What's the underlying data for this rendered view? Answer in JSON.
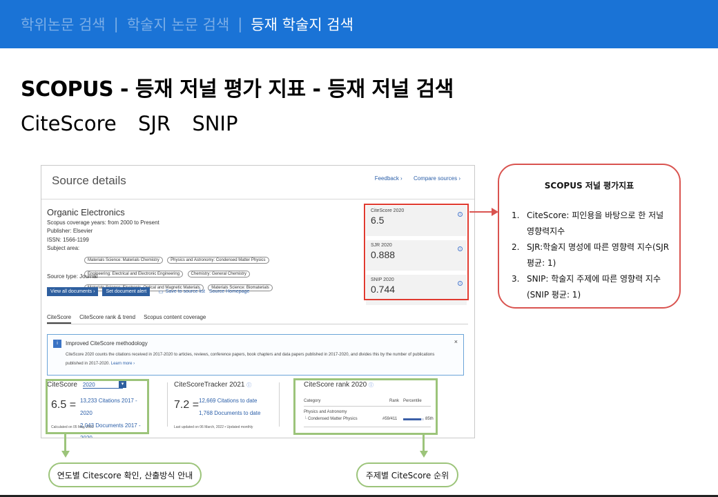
{
  "topbar": {
    "tabs": [
      {
        "label": "학위논문 검색"
      },
      {
        "label": "학술지 논문 검색"
      },
      {
        "label": "등재 학술지 검색"
      }
    ],
    "separator": "|",
    "colors": {
      "bar": "#1a73d6"
    }
  },
  "slide": {
    "title": "SCOPUS  -  등재 저널 평가 지표  -  등재 저널 검색",
    "subtitle": [
      "CiteScore",
      "SJR",
      "SNIP"
    ]
  },
  "source": {
    "header": "Source details",
    "feedback": "Feedback ›",
    "compare": "Compare sources ›",
    "journal_name": "Organic Electronics",
    "coverage_label": "Scopus coverage years:",
    "coverage_value": "from 2000 to Present",
    "publisher_label": "Publisher:",
    "publisher_value": "Elsevier",
    "issn_label": "ISSN:",
    "issn_value": "1566-1199",
    "subject_label": "Subject area:",
    "subjects": [
      "Materials Science: Materials Chemistry",
      "Physics and Astronomy: Condensed Matter Physics",
      "Engineering: Electrical and Electronic Engineering",
      "Chemistry: General Chemistry",
      "Materials Science: Electronic, Optical and Magnetic Materials",
      "Materials Science: Biomaterials"
    ],
    "source_type_label": "Source type:",
    "source_type_value": "Journal",
    "btn_view_all": "View all documents ›",
    "btn_alert": "Set document alert",
    "save_link": "Save to source list",
    "homepage_link": "Source Homepage",
    "metrics": [
      {
        "label": "CiteScore 2020",
        "value": "6.5"
      },
      {
        "label": "SJR 2020",
        "value": "0.888"
      },
      {
        "label": "SNIP 2020",
        "value": "0.744"
      }
    ],
    "info_icon": "i",
    "tabs": [
      "CiteScore",
      "CiteScore rank & trend",
      "Scopus content coverage"
    ],
    "notice": {
      "icon": "i",
      "title": "Improved CiteScore methodology",
      "body": "CiteScore 2020 counts the citations received in 2017-2020 to articles, reviews, conference papers, book chapters and data papers published in 2017-2020, and divides this by the number of publications published in 2017-2020.",
      "more": "Learn more ›",
      "close": "×"
    },
    "citescore_panel": {
      "title": "CiteScore",
      "year": "2020",
      "dropdown": "▾",
      "big": "6.5",
      "equals": "=",
      "citations": "13,233 Citations 2017 - 2020",
      "documents": "2,043 Documents 2017 - 2020",
      "foot": "Calculated on 05 May, 2021"
    },
    "tracker_panel": {
      "title": "CiteScoreTracker 2021",
      "big": "7.2",
      "equals": "=",
      "citations": "12,669 Citations to date",
      "documents": "1,768 Documents to date",
      "foot": "Last updated on 06 March, 2022 • Updated monthly"
    },
    "rank_panel": {
      "title": "CiteScore rank 2020",
      "col_category": "Category",
      "col_rank": "Rank",
      "col_percentile": "Percentile",
      "category_group": "Physics and Astronomy",
      "category_name": "Condensed Matter Physics",
      "rank": "#59/411",
      "percentile": "85th",
      "percentile_value": 0.85
    }
  },
  "callout": {
    "title": "SCOPUS 저널 평가지표",
    "items": [
      {
        "num": "1.",
        "text": "CiteScore: 피인용을 바탕으로 한 저널영향력지수"
      },
      {
        "num": "2.",
        "text": "SJR:학술지 명성에 따른 영향력 지수(SJR 평균: 1)"
      },
      {
        "num": "3.",
        "text": "SNIP: 학술지 주제에 따른 영향력 지수(SNIP 평균: 1)"
      }
    ]
  },
  "pills": {
    "left": "연도별 Citescore 확인, 산출방식 안내",
    "right": "주제별 CiteScore 순위"
  },
  "colors": {
    "red": "#e03a2f",
    "green": "#9cc47a",
    "link": "#2a5ea8"
  }
}
